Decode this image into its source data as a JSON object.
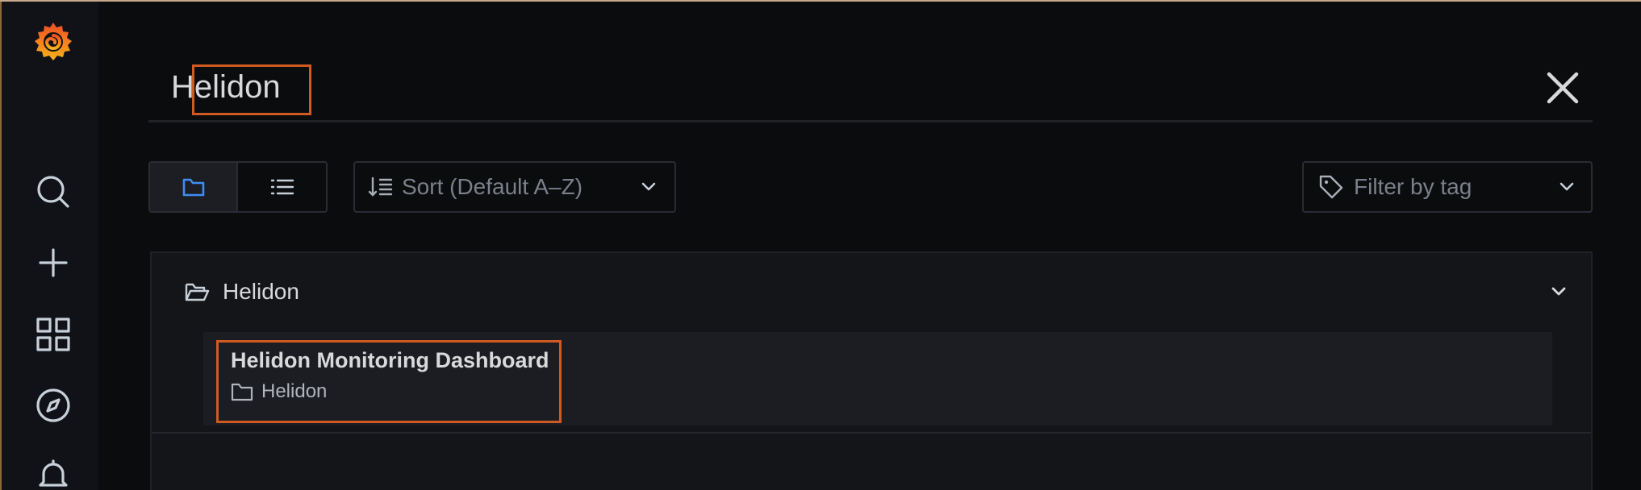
{
  "search": {
    "query": "Helidon",
    "placeholder": ""
  },
  "toolbar": {
    "view_folders_icon": "folder-icon",
    "view_list_icon": "list-icon",
    "sort_label": "Sort (Default A–Z)",
    "tag_filter_label": "Filter by tag"
  },
  "results": {
    "folder": {
      "title": "Helidon",
      "expanded": true
    },
    "dashboards": [
      {
        "title": "Helidon Monitoring Dashboard",
        "folder": "Helidon"
      }
    ]
  },
  "colors": {
    "accent_active": "#3d8df5",
    "highlight_box": "#d05a21",
    "brand_orange": "#f46800"
  }
}
